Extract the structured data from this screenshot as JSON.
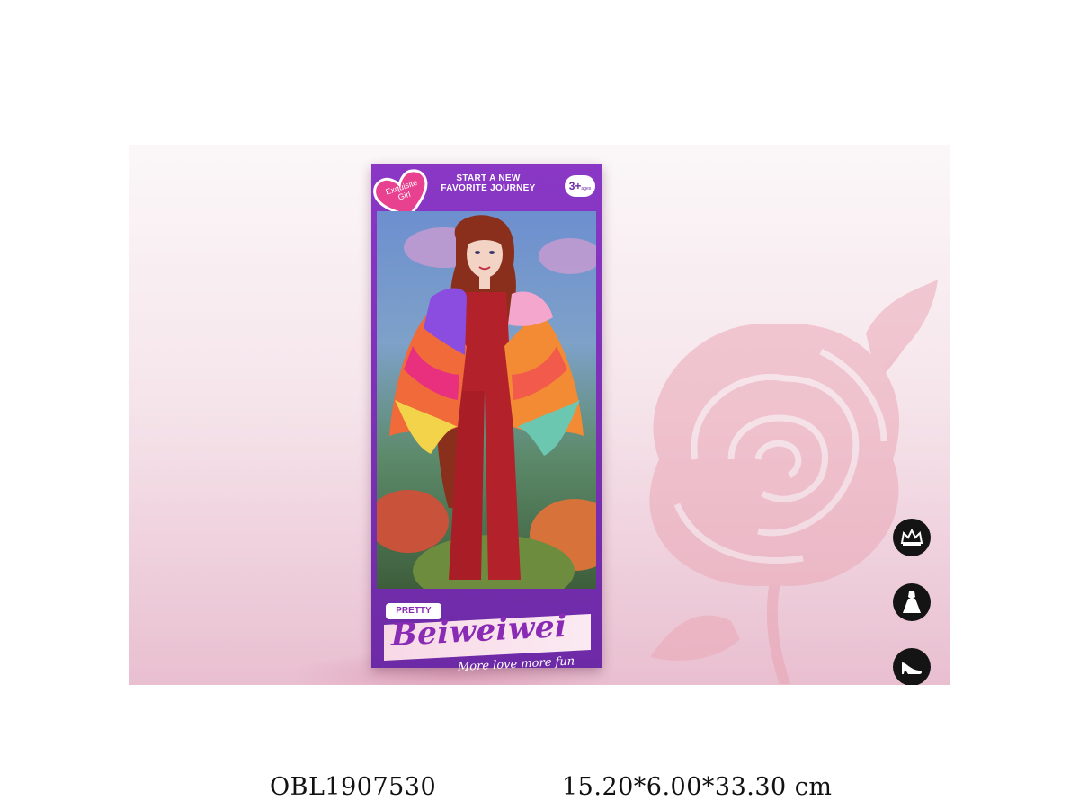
{
  "package": {
    "heart_badge": "Exquisite Girl",
    "tagline_line1": "START A NEW",
    "tagline_line2": "FAVORITE JOURNEY",
    "age_label": "3+",
    "age_sub": "ages",
    "brand_tag": "PRETTY",
    "brand_name": "Beiweiwei",
    "slogan": "More love more fun"
  },
  "features": [
    {
      "icon": "crown-icon"
    },
    {
      "icon": "dress-icon"
    },
    {
      "icon": "high-heel-icon"
    }
  ],
  "caption": {
    "item_code": "OBL1907530",
    "dimensions": "15.20*6.00*33.30 cm"
  },
  "colors": {
    "box_purple": "#7a30b6",
    "brand_pink": "#f7d9e6",
    "rose_pink": "#e9a3b3",
    "outfit_red": "#b3212b"
  }
}
